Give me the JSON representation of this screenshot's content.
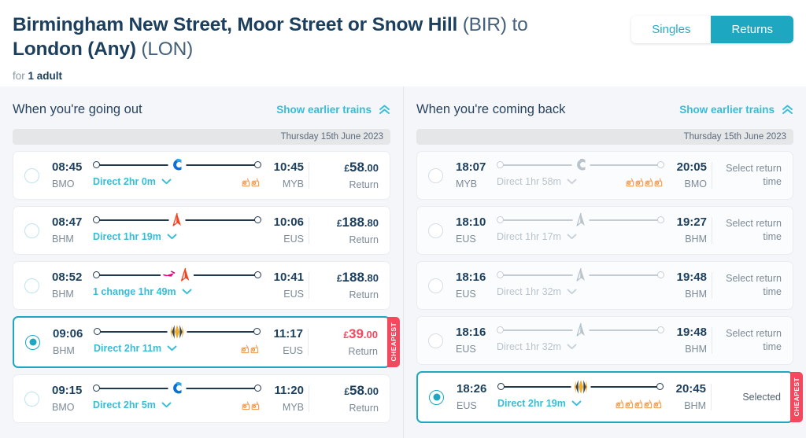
{
  "header": {
    "title_line1": "Birmingham New Street, Moor Street or Snow Hill",
    "title_code1": "(BIR)",
    "title_to": "to",
    "title_line2": "London (Any)",
    "title_code2": "(LON)",
    "pax_prefix": "for",
    "pax_value": "1 adult",
    "toggle": {
      "singles_label": "Singles",
      "returns_label": "Returns",
      "active": "Returns"
    }
  },
  "colors": {
    "accent_teal": "#1da7c0",
    "link_blue": "#36bdd8",
    "cheapest_red": "#f4485e",
    "text_dark": "#1c3f5e",
    "text_muted": "#7c8a98",
    "page_bg": "#f4f6f9"
  },
  "outbound": {
    "title": "When you're going out",
    "earlier_label": "Show earlier trains",
    "date_label": "Thursday 15th June 2023",
    "rows": [
      {
        "dep_time": "08:45",
        "dep_stn": "BMO",
        "arr_time": "10:45",
        "arr_stn": "MYB",
        "duration": "Direct 2hr 0m",
        "operators": [
          "chiltern"
        ],
        "crowding": 2,
        "price_currency": "£",
        "price_main": "58",
        "price_dec": ".00",
        "price_sub": "Return",
        "selected": false,
        "muted": false,
        "cheapest": false
      },
      {
        "dep_time": "08:47",
        "dep_stn": "BHM",
        "arr_time": "10:06",
        "arr_stn": "EUS",
        "duration": "Direct 1hr 19m",
        "operators": [
          "avanti"
        ],
        "crowding": 0,
        "price_currency": "£",
        "price_main": "188",
        "price_dec": ".80",
        "price_sub": "Return",
        "selected": false,
        "muted": false,
        "cheapest": false
      },
      {
        "dep_time": "08:52",
        "dep_stn": "BHM",
        "arr_time": "10:41",
        "arr_stn": "EUS",
        "duration": "1 change 1hr 49m",
        "operators": [
          "wmr",
          "avanti"
        ],
        "crowding": 0,
        "price_currency": "£",
        "price_main": "188",
        "price_dec": ".80",
        "price_sub": "Return",
        "selected": false,
        "muted": false,
        "cheapest": false
      },
      {
        "dep_time": "09:06",
        "dep_stn": "BHM",
        "arr_time": "11:17",
        "arr_stn": "EUS",
        "duration": "Direct 2hr 11m",
        "operators": [
          "lnwr"
        ],
        "crowding": 2,
        "price_currency": "£",
        "price_main": "39",
        "price_dec": ".00",
        "price_sub": "Return",
        "selected": true,
        "muted": false,
        "cheapest": true,
        "cheapest_label": "CHEAPEST"
      },
      {
        "dep_time": "09:15",
        "dep_stn": "BMO",
        "arr_time": "11:20",
        "arr_stn": "MYB",
        "duration": "Direct 2hr 5m",
        "operators": [
          "chiltern"
        ],
        "crowding": 2,
        "price_currency": "£",
        "price_main": "58",
        "price_dec": ".00",
        "price_sub": "Return",
        "selected": false,
        "muted": false,
        "cheapest": false
      }
    ]
  },
  "inbound": {
    "title": "When you're coming back",
    "earlier_label": "Show earlier trains",
    "date_label": "Thursday 15th June 2023",
    "rows": [
      {
        "dep_time": "18:07",
        "dep_stn": "MYB",
        "arr_time": "20:05",
        "arr_stn": "BMO",
        "duration": "Direct 1hr 58m",
        "operators": [
          "chiltern"
        ],
        "crowding": 4,
        "action": "Select return time",
        "selected": false,
        "muted": true,
        "cheapest": false
      },
      {
        "dep_time": "18:10",
        "dep_stn": "EUS",
        "arr_time": "19:27",
        "arr_stn": "BHM",
        "duration": "Direct 1hr 17m",
        "operators": [
          "avanti"
        ],
        "crowding": 0,
        "action": "Select return time",
        "selected": false,
        "muted": true,
        "cheapest": false
      },
      {
        "dep_time": "18:16",
        "dep_stn": "EUS",
        "arr_time": "19:48",
        "arr_stn": "BHM",
        "duration": "Direct 1hr 32m",
        "operators": [
          "avanti"
        ],
        "crowding": 0,
        "action": "Select return time",
        "selected": false,
        "muted": true,
        "cheapest": false
      },
      {
        "dep_time": "18:16",
        "dep_stn": "EUS",
        "arr_time": "19:48",
        "arr_stn": "BHM",
        "duration": "Direct 1hr 32m",
        "operators": [
          "avanti"
        ],
        "crowding": 0,
        "action": "Select return time",
        "selected": false,
        "muted": true,
        "cheapest": false
      },
      {
        "dep_time": "18:26",
        "dep_stn": "EUS",
        "arr_time": "20:45",
        "arr_stn": "BHM",
        "duration": "Direct 2hr 19m",
        "operators": [
          "lnwr"
        ],
        "crowding": 5,
        "action": "Selected",
        "selected": true,
        "muted": false,
        "cheapest": true,
        "cheapest_label": "CHEAPEST"
      }
    ]
  },
  "icons": {
    "chiltern": "chiltern-railways-logo",
    "avanti": "avanti-west-coast-logo",
    "wmr": "west-midlands-railway-logo",
    "lnwr": "london-northwestern-railway-logo",
    "crowding": "crowding-indicator-icon",
    "chevron_down": "chevron-down-icon",
    "chevron_up": "chevron-up-icon"
  }
}
